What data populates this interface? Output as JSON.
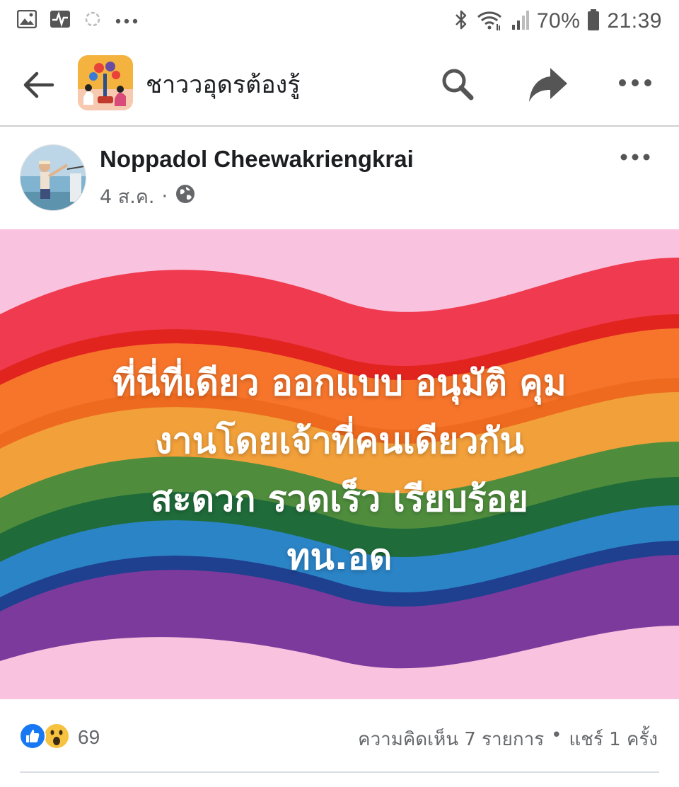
{
  "status_bar": {
    "battery": "70%",
    "time": "21:39",
    "icons": [
      "image-icon",
      "activity-icon",
      "sync-icon",
      "more-dots-icon",
      "bluetooth-icon",
      "wifi-icon",
      "signal-icon",
      "battery-icon"
    ]
  },
  "header": {
    "group_name": "ชาววอุดรต้องรู้",
    "icons": [
      "back-arrow-icon",
      "group-avatar",
      "search-icon",
      "share-icon",
      "more-icon"
    ]
  },
  "post": {
    "author": "Noppadol Cheewakriengkrai",
    "date": "4 ส.ค.",
    "separator": "·",
    "privacy_icon": "globe-icon",
    "text_lines": [
      "ที่นี่ที่เดียว ออกแบบ อนุมัติ คุม",
      "งานโดยเจ้าที่คนเดียวกัน",
      "สะดวก รวดเร็ว เรียบร้อย",
      "ทน.อด"
    ],
    "colors": {
      "background_pink": "#f9c3df",
      "red": "#ef3a4f",
      "orange": "#f6752b",
      "yellow": "#f2a03a",
      "green": "#4f8d3d",
      "blue": "#2b84c6",
      "purple": "#7c3b9c"
    }
  },
  "reactions": {
    "icons": [
      "like-reaction-icon",
      "wow-reaction-icon"
    ],
    "count": "69",
    "comments": "ความคิดเห็น 7 รายการ",
    "bullet": "•",
    "shares": "แชร์ 1 ครั้ง"
  }
}
